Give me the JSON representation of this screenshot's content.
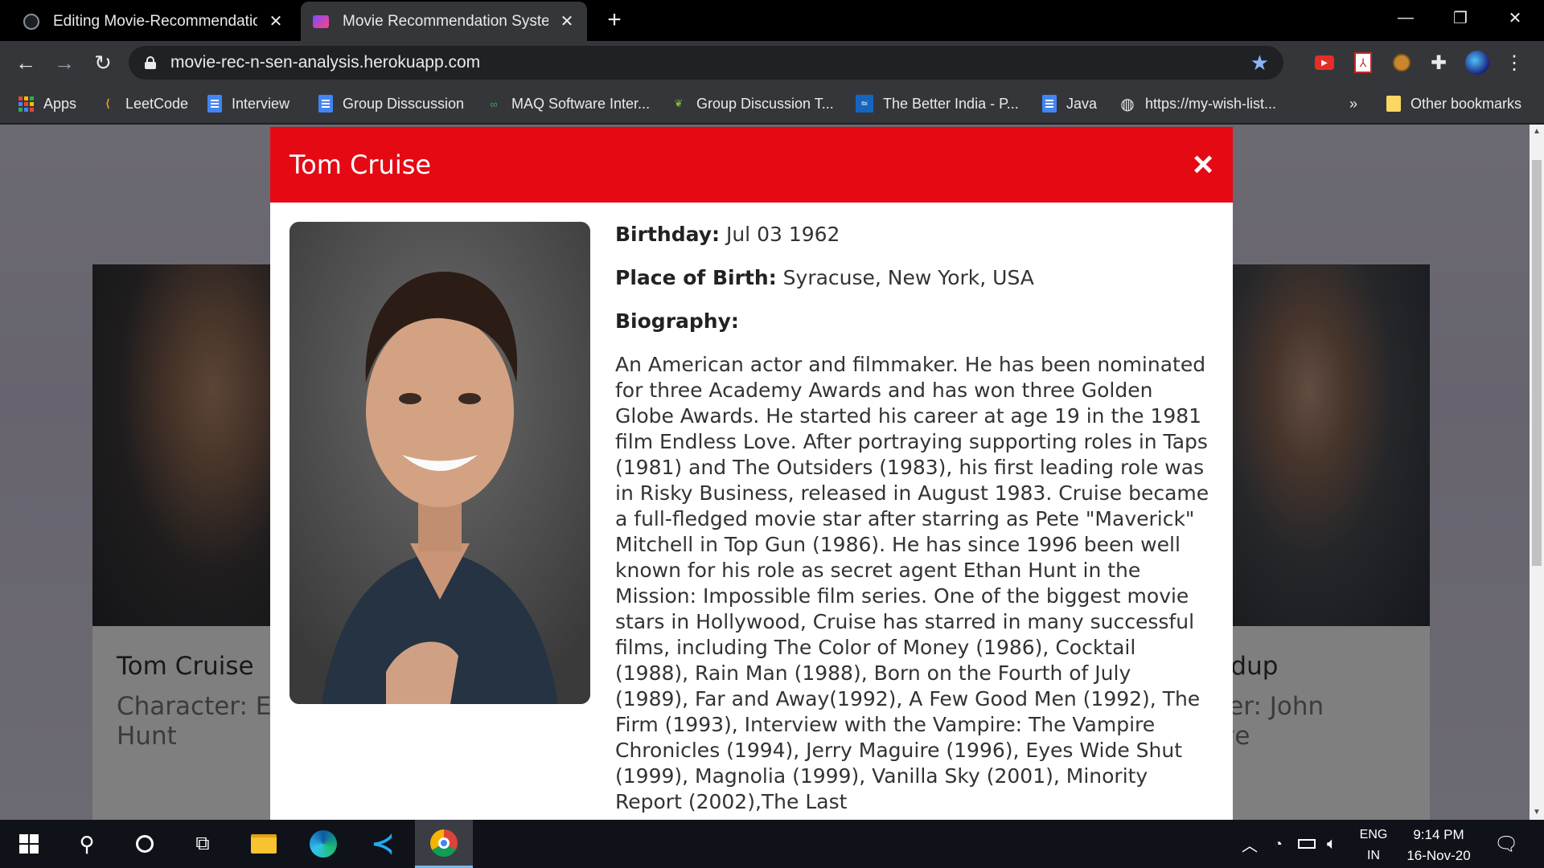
{
  "browser": {
    "tabs": [
      {
        "title": "Editing Movie-Recommendation",
        "icon": "github-icon",
        "active": false
      },
      {
        "title": "Movie Recommendation System",
        "icon": "app-icon",
        "active": true
      }
    ],
    "url": "movie-rec-n-sen-analysis.herokuapp.com",
    "bookmarks": [
      {
        "label": "Apps",
        "icon": "apps-grid-icon"
      },
      {
        "label": "LeetCode",
        "icon": "leetcode-icon"
      },
      {
        "label": "Interview",
        "icon": "docs-icon"
      },
      {
        "label": "Group Disscussion",
        "icon": "docs-icon"
      },
      {
        "label": "MAQ Software Inter...",
        "icon": "maq-icon"
      },
      {
        "label": "Group Discussion T...",
        "icon": "leaf-icon"
      },
      {
        "label": "The Better India - P...",
        "icon": "better-india-icon"
      },
      {
        "label": "Java",
        "icon": "docs-icon"
      },
      {
        "label": "https://my-wish-list...",
        "icon": "globe-icon"
      }
    ],
    "overflow_label": "»",
    "other_bookmarks": "Other bookmarks"
  },
  "background_cards": {
    "left": {
      "name": "Tom Cruise",
      "character": "Character: Eth Hunt"
    },
    "right": {
      "name": "rudup",
      "character": "cter: John ave"
    }
  },
  "modal": {
    "title": "Tom Cruise",
    "close_symbol": "×",
    "birthday_label": "Birthday:",
    "birthday": "Jul 03 1962",
    "birthplace_label": "Place of Birth:",
    "birthplace": "Syracuse, New York, USA",
    "biography_label": "Biography:",
    "biography": "An American actor and filmmaker. He has been nominated for three Academy Awards and has won three Golden Globe Awards. He started his career at age 19 in the 1981 film Endless Love. After portraying supporting roles in Taps (1981) and The Outsiders (1983), his first leading role was in Risky Business, released in August 1983. Cruise became a full-fledged movie star after starring as Pete \"Maverick\" Mitchell in Top Gun (1986). He has since 1996 been well known for his role as secret agent Ethan Hunt in the Mission: Impossible film series. One of the biggest movie stars in Hollywood, Cruise has starred in many successful films, including The Color of Money (1986), Cocktail (1988), Rain Man (1988), Born on the Fourth of July (1989), Far and Away(1992), A Few Good Men (1992), The Firm (1993), Interview with the Vampire: The Vampire Chronicles (1994), Jerry Maguire (1996), Eyes Wide Shut (1999), Magnolia (1999), Vanilla Sky (2001), Minority Report (2002),The Last"
  },
  "taskbar": {
    "lang_top": "ENG",
    "lang_bottom": "IN",
    "time": "9:14 PM",
    "date": "16-Nov-20"
  },
  "colors": {
    "modal_header": "#e50914",
    "tab_strip": "#000000",
    "toolbar": "#35363a"
  }
}
